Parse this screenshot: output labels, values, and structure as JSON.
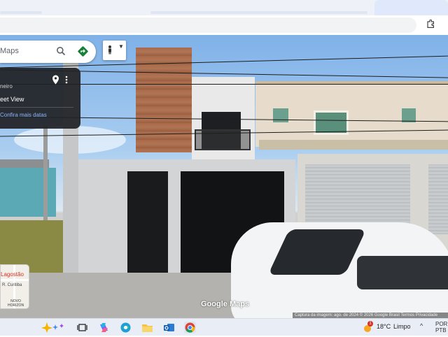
{
  "maps": {
    "search_text": "Maps",
    "search_icon": "search-icon",
    "directions_icon": "directions-icon",
    "pegman_icon": "pegman-icon"
  },
  "info_card": {
    "location": "neiro",
    "title": "eet View",
    "link": "Confira mais datas"
  },
  "minimap": {
    "place": "Lagostão",
    "street": "R. Curitiba",
    "district_line1": "NOVO",
    "district_line2": "HORIZON"
  },
  "watermark": "Google Maps",
  "attribution": "Captura da imagem: ago. de 2024   © 2026 Google   Brasil   Termos   Privacidade",
  "taskbar": {
    "weather_temp": "18°C",
    "weather_desc": "Limpo",
    "weather_badge": "1",
    "lang": "POR PTB"
  },
  "colors": {
    "accent_blue": "#1a73e8",
    "directions_green": "#188038",
    "link_blue": "#8ab4f8"
  }
}
